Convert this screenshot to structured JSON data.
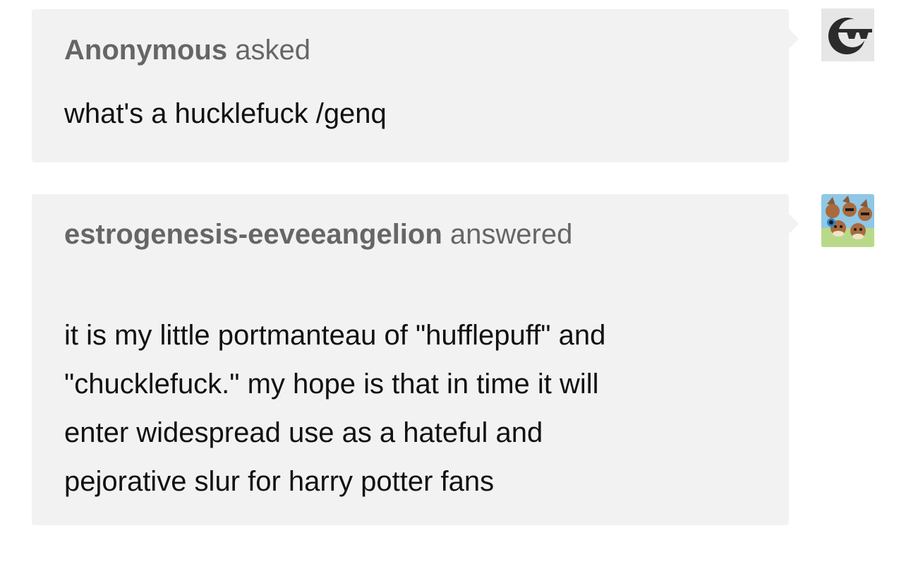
{
  "ask": {
    "asker": "Anonymous",
    "verb": "asked",
    "question": "what's a hucklefuck /genq",
    "avatar_icon": "anonymous-sunglasses-icon"
  },
  "answer": {
    "answerer": "estrogenesis-eeveeangelion",
    "verb": "answered",
    "lines": [
      "it is my little portmanteau of \"hufflepuff\" and",
      "\"chucklefuck.\" my hope is that in time it will",
      "enter widespread use as a hateful and",
      "pejorative slur for harry potter fans"
    ],
    "avatar_icon": "eevee-collage-avatar-icon"
  },
  "colors": {
    "bubble_bg": "#f2f2f2",
    "header_text": "#666666",
    "body_text": "#111111"
  }
}
